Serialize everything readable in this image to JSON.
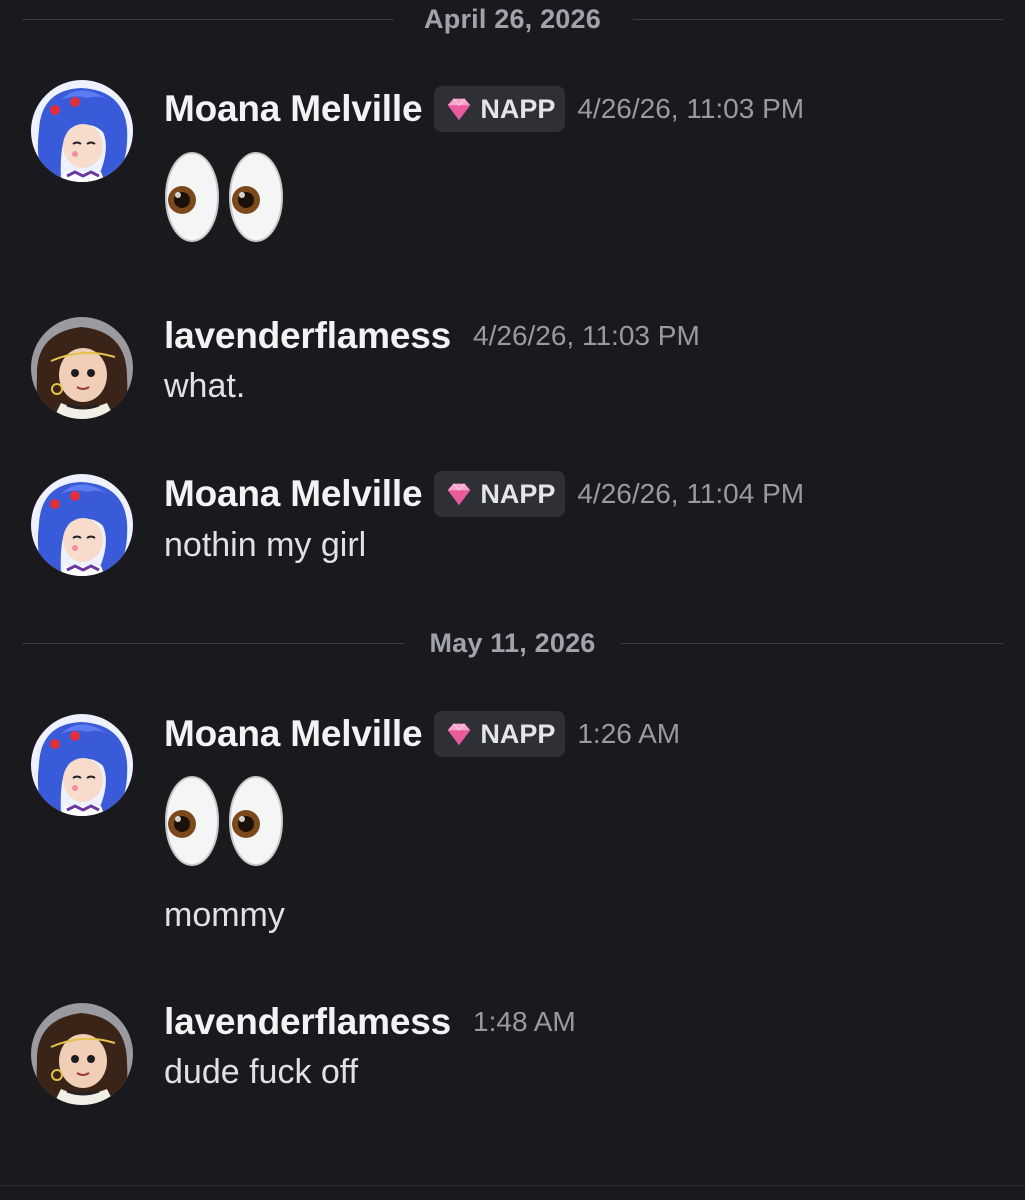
{
  "dividers": [
    {
      "label": "April 26, 2026"
    },
    {
      "label": "May 11, 2026"
    }
  ],
  "messages": [
    {
      "author": "Moana Melville",
      "tag": "NAPP",
      "time": "4/26/26, 11:03 PM",
      "emoji": "eyes-emoji"
    },
    {
      "author": "lavenderflamess",
      "time": "4/26/26, 11:03 PM",
      "text": "what."
    },
    {
      "author": "Moana Melville",
      "tag": "NAPP",
      "time": "4/26/26, 11:04 PM",
      "text": "nothin my girl"
    },
    {
      "author": "Moana Melville",
      "tag": "NAPP",
      "time": "1:26 AM",
      "emoji": "eyes-emoji",
      "text": "mommy"
    },
    {
      "author": "lavenderflamess",
      "time": "1:48 AM",
      "text": "dude fuck off"
    }
  ],
  "colors": {
    "background": "#1a1a1e",
    "tag_background": "#2f3036",
    "tag_gem": "#ef6fa8",
    "timestamp": "#989aa2"
  }
}
